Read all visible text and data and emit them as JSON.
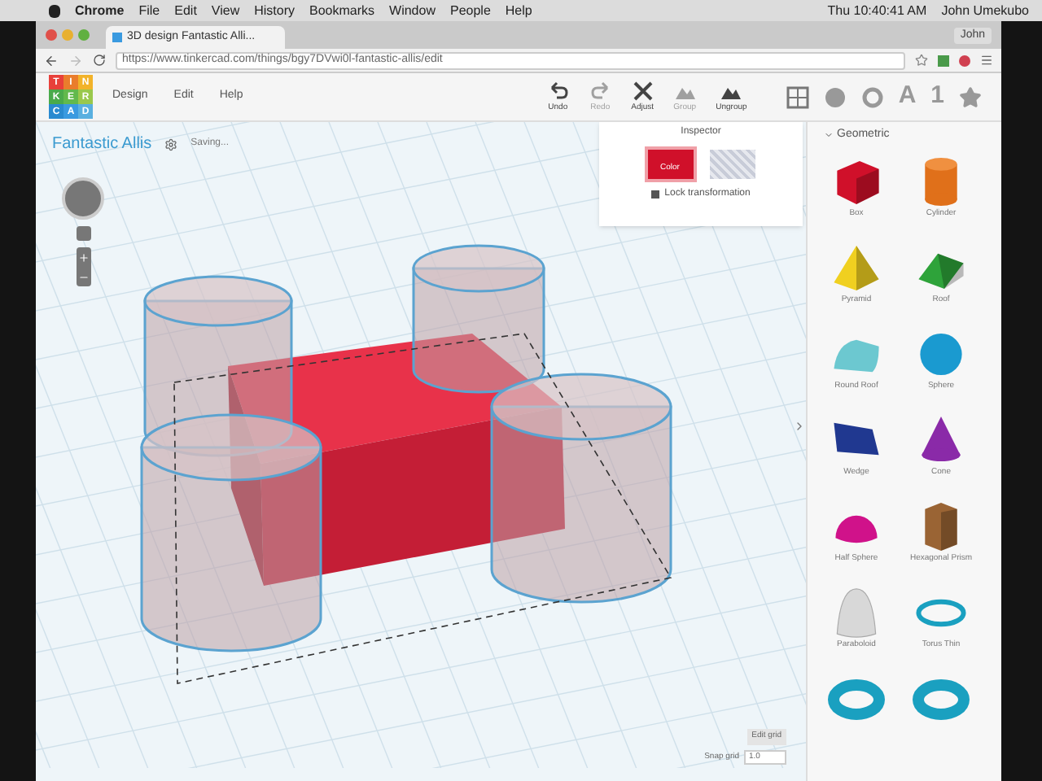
{
  "menu_bar": {
    "items": [
      "Chrome",
      "File",
      "Edit",
      "View",
      "History",
      "Bookmarks",
      "Window",
      "People",
      "Help"
    ],
    "clock": "Thu 10:40:41 AM",
    "user": "John Umekubo"
  },
  "browser": {
    "tab": "3D design Fantastic Alli...",
    "profile": "John",
    "url": "https://www.tinkercad.com/things/bgy7DVwi0l-fantastic-allis/edit"
  },
  "app": {
    "logo": [
      "T",
      "I",
      "N",
      "K",
      "E",
      "R",
      "C",
      "A",
      "D"
    ],
    "menu": [
      "Design",
      "Edit",
      "Help"
    ],
    "toolbar": [
      {
        "kind": "undo",
        "label": "Undo",
        "disabled": false
      },
      {
        "kind": "redo",
        "label": "Redo",
        "disabled": true
      },
      {
        "kind": "adjust",
        "label": "Adjust",
        "disabled": false
      },
      {
        "kind": "group",
        "label": "Group",
        "disabled": true
      },
      {
        "kind": "ungroup",
        "label": "Ungroup",
        "disabled": false
      }
    ],
    "view_tabs": [
      {
        "kind": "grid",
        "selected": true
      },
      {
        "kind": "ball",
        "selected": false
      },
      {
        "kind": "ring",
        "selected": false
      },
      {
        "kind": "text",
        "label": "A",
        "selected": false
      },
      {
        "kind": "text",
        "label": "1",
        "selected": false
      },
      {
        "kind": "star",
        "selected": false
      }
    ]
  },
  "design": {
    "title": "Fantastic Allis",
    "status": "Saving..."
  },
  "inspector": {
    "title": "Inspector",
    "swatches": [
      {
        "kind": "solid",
        "label": "Color",
        "selected": true
      },
      {
        "kind": "hole",
        "selected": false
      }
    ],
    "lock": "Lock transformation"
  },
  "grid": {
    "edit_button": "Edit grid",
    "snap_label": "Snap grid",
    "snap_value": "1.0"
  },
  "shapes": {
    "category": "Geometric",
    "items": [
      {
        "kind": "box",
        "label": "Box",
        "color": "#d0102a"
      },
      {
        "kind": "cylinder",
        "label": "Cylinder",
        "color": "#e0701a"
      },
      {
        "kind": "pyramid",
        "label": "Pyramid",
        "color": "#f0d020"
      },
      {
        "kind": "roof",
        "label": "Roof",
        "color": "#2ea33a"
      },
      {
        "kind": "roundroof",
        "label": "Round Roof",
        "color": "#6cc8d0"
      },
      {
        "kind": "sphere",
        "label": "Sphere",
        "color": "#1a9ad0"
      },
      {
        "kind": "wedge",
        "label": "Wedge",
        "color": "#203890"
      },
      {
        "kind": "cone",
        "label": "Cone",
        "color": "#8a2aa8"
      },
      {
        "kind": "halfsphere",
        "label": "Half Sphere",
        "color": "#d0128a"
      },
      {
        "kind": "hexprism",
        "label": "Hexagonal Prism",
        "color": "#9a6434"
      },
      {
        "kind": "paraboloid",
        "label": "Paraboloid",
        "color": "#d8d8d8"
      },
      {
        "kind": "torusthin",
        "label": "Torus Thin",
        "color": "#1aa0c0"
      },
      {
        "kind": "torus",
        "color": "#1aa0c0"
      },
      {
        "kind": "torus",
        "color": "#1aa0c0"
      }
    ]
  }
}
